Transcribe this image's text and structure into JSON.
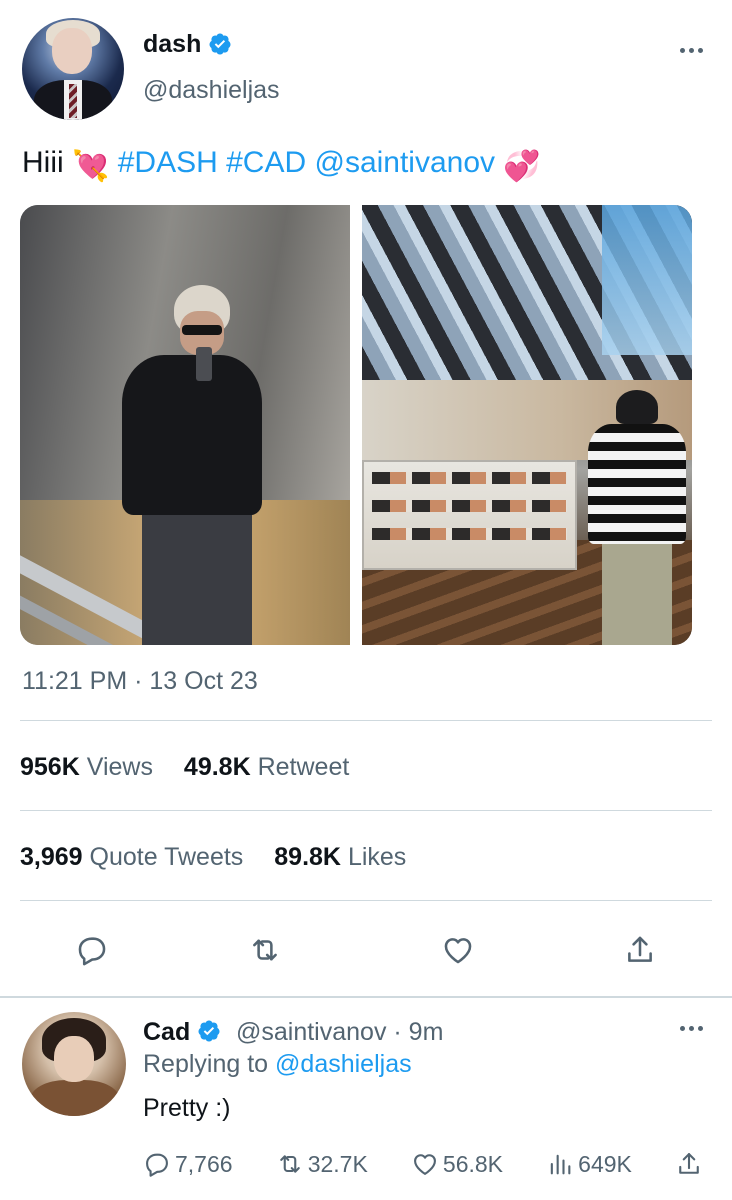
{
  "tweet": {
    "author": {
      "name": "dash",
      "handle": "@dashieljas",
      "verified": true,
      "avatar_icon": "profile-photo"
    },
    "text": {
      "greeting": "Hiii",
      "emoji_1": "💘",
      "hashtag_1": "#DASH",
      "hashtag_2": "#CAD",
      "mention": "@saintivanov",
      "emoji_2": "💞"
    },
    "media_count": 2,
    "timestamp": "11:21 PM · 13 Oct 23",
    "stats_row_1": [
      {
        "value": "956K",
        "label": "Views"
      },
      {
        "value": "49.8K",
        "label": "Retweet"
      }
    ],
    "stats_row_2": [
      {
        "value": "3,969",
        "label": "Quote Tweets"
      },
      {
        "value": "89.8K",
        "label": "Likes"
      }
    ],
    "actions": [
      "reply-icon",
      "retweet-icon",
      "like-icon",
      "share-icon"
    ]
  },
  "reply": {
    "author": {
      "name": "Cad",
      "handle": "@saintivanov",
      "time": "· 9m",
      "verified": true
    },
    "replying_prefix": "Replying to",
    "replying_to": "@dashieljas",
    "text": "Pretty :)",
    "counts": {
      "replies": "7,766",
      "retweets": "32.7K",
      "likes": "56.8K",
      "views": "649K"
    }
  },
  "colors": {
    "accent": "#1d9bf0",
    "text": "#0f1419",
    "muted": "#536471",
    "divider": "#cfd9de"
  }
}
